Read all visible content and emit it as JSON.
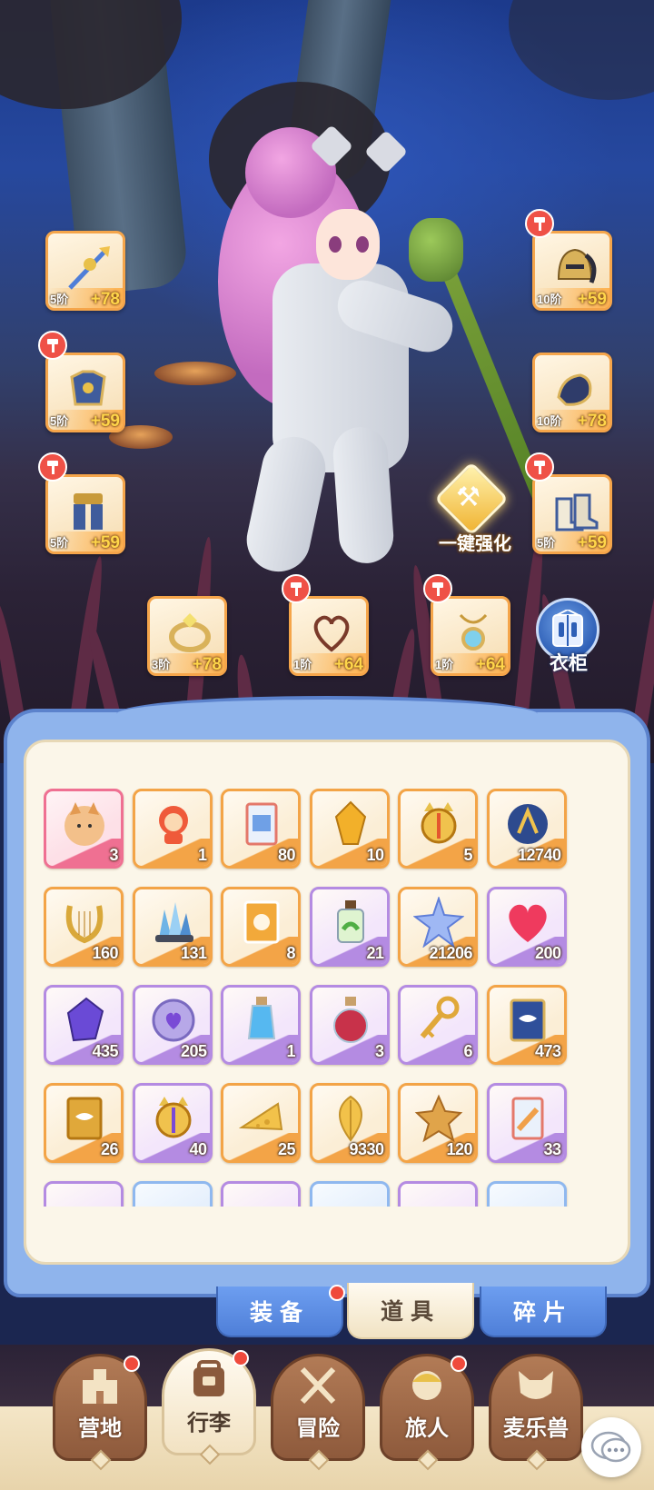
{
  "equipment": [
    {
      "id": "weapon",
      "tier": "5阶",
      "plus": "+78",
      "icon": "golden-spear-icon",
      "badge": false
    },
    {
      "id": "helmet",
      "tier": "10阶",
      "plus": "+59",
      "icon": "knight-helmet-icon",
      "badge": true
    },
    {
      "id": "armor",
      "tier": "5阶",
      "plus": "+59",
      "icon": "chest-armor-icon",
      "badge": true
    },
    {
      "id": "gloves",
      "tier": "10阶",
      "plus": "+78",
      "icon": "gauntlet-icon",
      "badge": false
    },
    {
      "id": "pants",
      "tier": "5阶",
      "plus": "+59",
      "icon": "leg-armor-icon",
      "badge": true
    },
    {
      "id": "boots",
      "tier": "5阶",
      "plus": "+59",
      "icon": "boots-icon",
      "badge": true
    },
    {
      "id": "ring",
      "tier": "3阶",
      "plus": "+78",
      "icon": "gem-ring-icon",
      "badge": false
    },
    {
      "id": "necklace",
      "tier": "1阶",
      "plus": "+64",
      "icon": "heart-necklace-icon",
      "badge": true
    },
    {
      "id": "amulet",
      "tier": "1阶",
      "plus": "+64",
      "icon": "gem-amulet-icon",
      "badge": true
    }
  ],
  "actions": {
    "one_click_upgrade": "一键强化",
    "wardrobe": "衣柜"
  },
  "inventory": [
    {
      "count": "3",
      "rarity": "pink",
      "icon": "fox-portrait-icon"
    },
    {
      "count": "1",
      "rarity": "orange",
      "icon": "red-hood-cat-icon"
    },
    {
      "count": "80",
      "rarity": "orange",
      "icon": "ticket-pack-icon"
    },
    {
      "count": "10",
      "rarity": "orange",
      "icon": "amber-crystal-icon"
    },
    {
      "count": "5",
      "rarity": "orange",
      "icon": "cat-ear-orb-orange-icon"
    },
    {
      "count": "12740",
      "rarity": "orange",
      "icon": "rune-orb-icon"
    },
    {
      "count": "160",
      "rarity": "orange",
      "icon": "golden-lyre-icon"
    },
    {
      "count": "131",
      "rarity": "orange",
      "icon": "blue-crystal-cluster-icon"
    },
    {
      "count": "8",
      "rarity": "orange",
      "icon": "costume-card-icon"
    },
    {
      "count": "21",
      "rarity": "purple",
      "icon": "green-potion-bottle-icon"
    },
    {
      "count": "21206",
      "rarity": "orange",
      "icon": "star-crystal-icon"
    },
    {
      "count": "200",
      "rarity": "purple",
      "icon": "red-heart-icon"
    },
    {
      "count": "435",
      "rarity": "purple",
      "icon": "purple-crystal-icon"
    },
    {
      "count": "205",
      "rarity": "purple",
      "icon": "heart-coin-icon"
    },
    {
      "count": "1",
      "rarity": "purple",
      "icon": "blue-potion-icon"
    },
    {
      "count": "3",
      "rarity": "purple",
      "icon": "red-potion-icon"
    },
    {
      "count": "6",
      "rarity": "purple",
      "icon": "golden-key-icon"
    },
    {
      "count": "473",
      "rarity": "orange",
      "icon": "blue-eye-card-icon"
    },
    {
      "count": "26",
      "rarity": "orange",
      "icon": "gold-eye-card-icon"
    },
    {
      "count": "40",
      "rarity": "purple",
      "icon": "cat-ear-orb-purple-icon"
    },
    {
      "count": "25",
      "rarity": "orange",
      "icon": "cheese-icon"
    },
    {
      "count": "9330",
      "rarity": "orange",
      "icon": "golden-leaf-icon"
    },
    {
      "count": "120",
      "rarity": "orange",
      "icon": "star-cookie-icon"
    },
    {
      "count": "33",
      "rarity": "purple",
      "icon": "blue-ticket-pack-icon"
    },
    {
      "count": "",
      "rarity": "purple",
      "icon": "scroll-icon"
    },
    {
      "count": "",
      "rarity": "blue",
      "icon": "ice-crystal-icon"
    },
    {
      "count": "",
      "rarity": "purple",
      "icon": "red-book-icon"
    },
    {
      "count": "",
      "rarity": "blue",
      "icon": "basket-icon"
    },
    {
      "count": "",
      "rarity": "purple",
      "icon": "dark-stone-icon"
    },
    {
      "count": "",
      "rarity": "blue",
      "icon": "paper-bag-icon"
    }
  ],
  "subtabs": [
    {
      "label": "装备",
      "active": false,
      "badge": true
    },
    {
      "label": "道具",
      "active": true,
      "badge": false
    },
    {
      "label": "碎片",
      "active": false,
      "badge": false
    }
  ],
  "nav": [
    {
      "label": "营地",
      "icon": "castle-icon",
      "active": false,
      "badge": true
    },
    {
      "label": "行李",
      "icon": "backpack-icon",
      "active": true,
      "badge": true
    },
    {
      "label": "冒险",
      "icon": "crossed-swords-icon",
      "active": false,
      "badge": false
    },
    {
      "label": "旅人",
      "icon": "traveler-portrait-icon",
      "active": false,
      "badge": true
    },
    {
      "label": "麦乐兽",
      "icon": "fox-head-icon",
      "active": false,
      "badge": false
    }
  ],
  "colors": {
    "rarity_orange": "#f3a447",
    "rarity_purple": "#b48be2",
    "rarity_pink": "#ef7092",
    "rarity_blue": "#8fb8ef",
    "badge_red": "#ef4a3c",
    "panel_blue": "#8fb4ec"
  }
}
